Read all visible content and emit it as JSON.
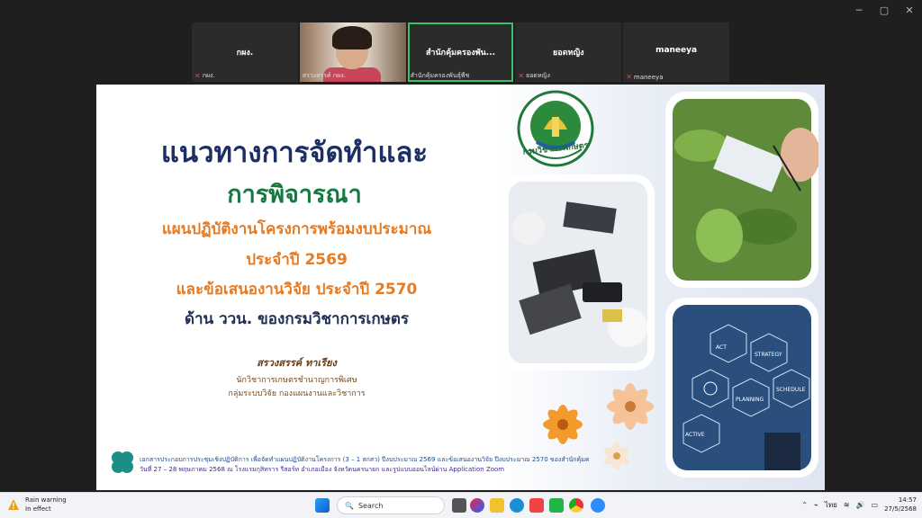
{
  "window": {
    "controls": [
      "─",
      "▢",
      "✕"
    ]
  },
  "participants": [
    {
      "name": "กผง.",
      "label": "กผง.",
      "muted": true,
      "video": false
    },
    {
      "name": "",
      "label": "สรวงสรรค์ กผง.",
      "muted": false,
      "video": true
    },
    {
      "name": "สำนักคุ้มครองพัน...",
      "label": "สำนักคุ้มครองพันธุ์พืช",
      "muted": false,
      "video": false,
      "active": true
    },
    {
      "name": "ยอดหญิง",
      "label": "ยอดหญิง",
      "muted": true,
      "video": false
    },
    {
      "name": "maneeya",
      "label": "maneeya",
      "muted": true,
      "video": false
    }
  ],
  "slide": {
    "title_line1": "แนวทางการจัดทำและ",
    "title_line2": "การพิจารณา",
    "sub_line1": "แผนปฏิบัติงานโครงการพร้อมงบประมาณ",
    "sub_line2": "ประจำปี 2569",
    "sub_line3": "และข้อเสนองานวิจัย ประจำปี 2570",
    "sub_line4": "ด้าน ววน. ของกรมวิชาการเกษตร",
    "author": "สรวงสรรค์ ทาเรียง",
    "author_title": "นักวิชาการเกษตรชำนาญการพิเศษ",
    "author_dept": "กลุ่มระบบวิจัย กองแผนงานและวิชาการ",
    "footer_line1": "เอกสารประกอบการประชุมเชิงปฏิบัติการ เพื่อจัดทำแผนปฏิบัติงานโครงการ (3 – 1 สกสว) ปีงบประมาณ 2569 และข้อเสนองานวิจัย ปีงบประมาณ 2570 ของสำนักคุ้มครองพันธุ์พืช",
    "footer_line2": "วันที่ 27 – 28 พฤษภาคม 2568 ณ โรงแรมกุสิทราร รีสอร์ท อำเภอเมือง จังหวัดนครนายก และรูปแบบออนไลน์ผ่าน Application Zoom",
    "logo_caption": "กรมวิชาการเกษตร",
    "hex_labels": [
      "ACT",
      "STRATEGY",
      "SCHEDULE",
      "PLANNING",
      "ACTIVE"
    ]
  },
  "taskbar": {
    "weather_title": "Rain warning",
    "weather_sub": "In effect",
    "search_placeholder": "Search",
    "language": "ไทย",
    "time": "14:57",
    "date": "27/5/2568"
  },
  "colors": {
    "title": "#1d2f62",
    "green": "#157840",
    "orange": "#e87a21",
    "active_border": "#3bc16a"
  }
}
